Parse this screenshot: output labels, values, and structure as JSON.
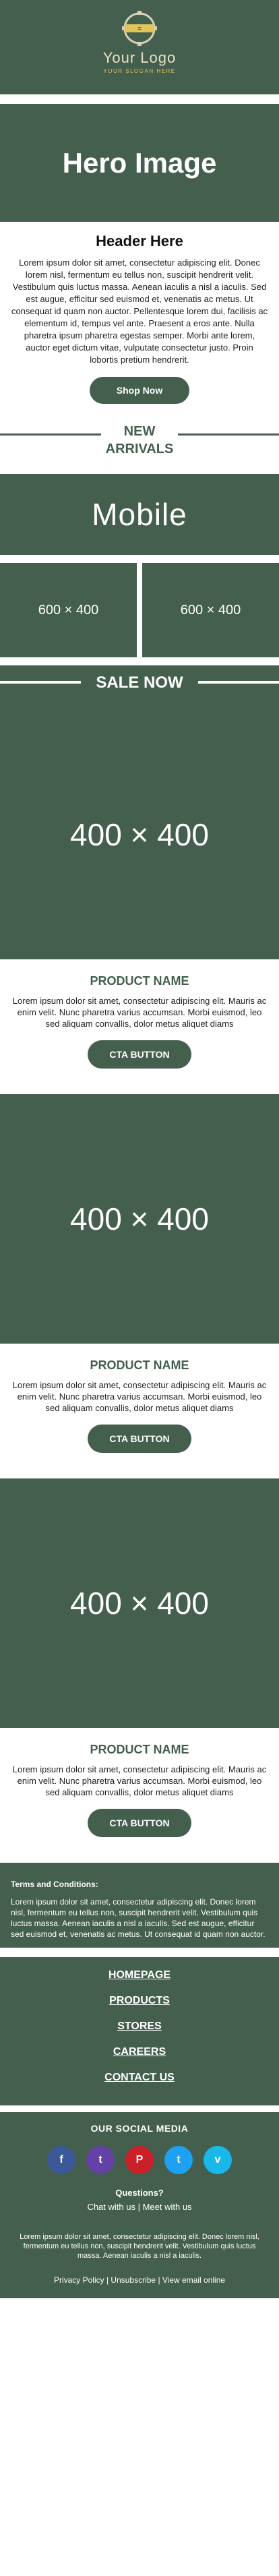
{
  "header": {
    "logo_title": "Your Logo",
    "logo_tagline": "YOUR SLOGAN HERE"
  },
  "hero": {
    "title": "Hero Image"
  },
  "intro": {
    "heading": "Header Here",
    "body": "Lorem ipsum dolor sit amet, consectetur adipiscing elit. Donec lorem nisl, fermentum eu tellus non, suscipit hendrerit velit. Vestibulum quis luctus massa. Aenean iaculis a nisl a iaculis. Sed est augue, efficitur sed euismod et, venenatis ac metus. Ut consequat id quam non auctor. Pellentesque lorem dui, facilisis ac elementum id, tempus vel ante. Praesent a eros ante. Nulla pharetra ipsum pharetra egestas semper. Morbi ante lorem, auctor eget dictum vitae, vulputate consectetur justo. Proin lobortis pretium hendrerit.",
    "button": "Shop Now"
  },
  "arrivals": {
    "line1": "NEW",
    "line2": "ARRIVALS"
  },
  "mobile": {
    "title": "Mobile",
    "left": "600 × 400",
    "right": "600 × 400"
  },
  "sale": {
    "label": "SALE NOW"
  },
  "products": [
    {
      "image_label": "400 × 400",
      "name": "PRODUCT NAME",
      "desc": "Lorem ipsum dolor sit amet, consectetur adipiscing elit. Mauris ac enim velit. Nunc pharetra varius accumsan. Morbi euismod, leo sed aliquam convallis, dolor metus aliquet diams",
      "button": "CTA BUTTON"
    },
    {
      "image_label": "400 × 400",
      "name": "PRODUCT NAME",
      "desc": "Lorem ipsum dolor sit amet, consectetur adipiscing elit. Mauris ac enim velit. Nunc pharetra varius accumsan. Morbi euismod, leo sed aliquam convallis, dolor metus aliquet diams",
      "button": "CTA BUTTON"
    },
    {
      "image_label": "400 × 400",
      "name": "PRODUCT NAME",
      "desc": "Lorem ipsum dolor sit amet, consectetur adipiscing elit. Mauris ac enim velit. Nunc pharetra varius accumsan. Morbi euismod, leo sed aliquam convallis, dolor metus aliquet diams",
      "button": "CTA BUTTON"
    }
  ],
  "terms": {
    "title": "Terms and Conditions:",
    "body": "Lorem ipsum dolor sit amet, consectetur adipiscing elit. Donec lorem nisl, fermentum eu tellus non, suscipit hendrerit velit. Vestibulum quis luctus massa. Aenean iaculis a nisl a iaculis. Sed est augue, efficitur sed euismod et, venenatis ac metus. Ut consequat id quam non auctor."
  },
  "nav_links": [
    "HOMEPAGE",
    "PRODUCTS",
    "STORES",
    "CAREERS",
    "CONTACT US"
  ],
  "social": {
    "title": "OUR SOCIAL MEDIA",
    "icons": [
      {
        "name": "facebook-icon",
        "glyph": "f",
        "color": "#3b5998"
      },
      {
        "name": "twitch-icon",
        "glyph": "t",
        "color": "#6441a5"
      },
      {
        "name": "pinterest-icon",
        "glyph": "P",
        "color": "#cb2027"
      },
      {
        "name": "twitter-icon",
        "glyph": "t",
        "color": "#1da1f2"
      },
      {
        "name": "vimeo-icon",
        "glyph": "v",
        "color": "#1ab7ea"
      }
    ],
    "question": "Questions?",
    "question_sub": "Chat with us | Meet with us"
  },
  "fineprint": "Lorem ipsum dolor sit amet, consectetur adipiscing elit. Donec lorem nisl, fermentum eu tellus non, suscipit hendrerit velit. Vestibulum quis luctus massa. Aenean iaculis a nisl a iaculis.",
  "bottom_links": "Privacy Policy | Unsubscribe | View email online",
  "colors": {
    "brand_green": "#445f4e",
    "logo_text": "#e9e2c6",
    "logo_accent": "#e1c55a"
  }
}
